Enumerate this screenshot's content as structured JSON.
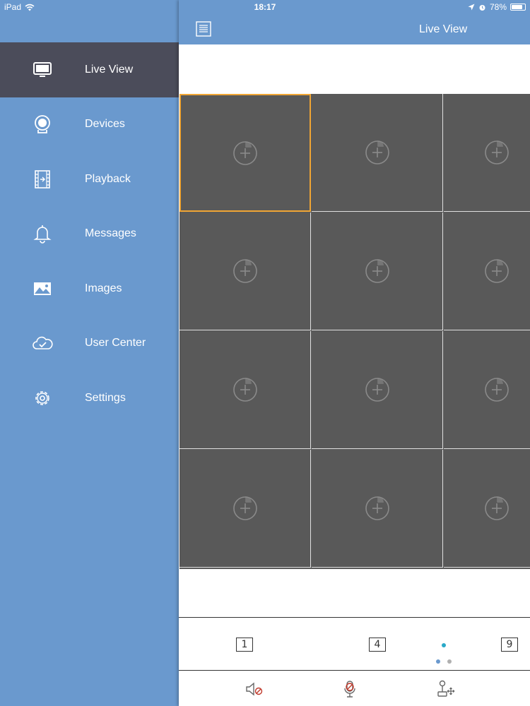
{
  "status_bar": {
    "device": "iPad",
    "time": "18:17",
    "battery": "78%"
  },
  "sidebar": {
    "items": [
      {
        "label": "Live View",
        "icon": "monitor-icon",
        "active": true
      },
      {
        "label": "Devices",
        "icon": "camera-icon",
        "active": false
      },
      {
        "label": "Playback",
        "icon": "film-icon",
        "active": false
      },
      {
        "label": "Messages",
        "icon": "bell-icon",
        "active": false
      },
      {
        "label": "Images",
        "icon": "image-icon",
        "active": false
      },
      {
        "label": "User Center",
        "icon": "cloud-check-icon",
        "active": false
      },
      {
        "label": "Settings",
        "icon": "gear-icon",
        "active": false
      }
    ]
  },
  "header": {
    "title": "Live View",
    "menu_icon": "list-icon"
  },
  "grid": {
    "rows": 4,
    "visible_columns": 3,
    "selected_cell": 0,
    "cell_icon": "add-camera-icon"
  },
  "layout_buttons": [
    "1",
    "4",
    "9"
  ],
  "pagination": {
    "pages": 2,
    "current": 1
  },
  "toolbar": {
    "items": [
      "mute-audio-icon",
      "mute-mic-icon",
      "ptz-joystick-icon"
    ]
  },
  "colors": {
    "accent": "#6a99ce",
    "active_menu": "#4b4c5a",
    "cell_bg": "#595959",
    "selected_border": "#f0a534",
    "dot_active": "#2aa9c8",
    "icon_red": "#c0392b"
  }
}
